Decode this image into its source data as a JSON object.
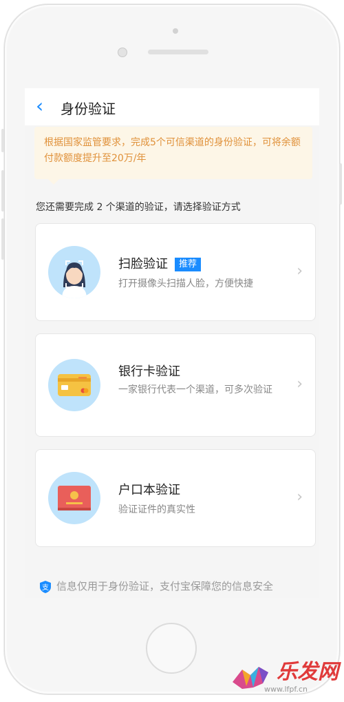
{
  "header": {
    "title": "身份验证",
    "back_icon": "chevron-left-icon"
  },
  "notice": {
    "text": "根据国家监管要求，完成5个可信渠道的身份验证，可将余额付款额度提升至20万/年"
  },
  "prompt": "您还需要完成 2 个渠道的验证，请选择验证方式",
  "methods": [
    {
      "title": "扫脸验证",
      "badge": "推荐",
      "desc": "打开摄像头扫描人脸，方便快捷",
      "icon": "face-scan-icon"
    },
    {
      "title": "银行卡验证",
      "desc": "一家银行代表一个渠道，可多次验证",
      "icon": "bank-card-icon"
    },
    {
      "title": "户口本验证",
      "desc": "验证证件的真实性",
      "icon": "household-register-icon"
    }
  ],
  "footer": {
    "text": "信息仅用于身份验证，支付宝保障您的信息安全",
    "icon": "shield-icon"
  },
  "watermark": {
    "title": "乐发网",
    "url": "www.lfpf.cn"
  },
  "colors": {
    "accent": "#1a8cff",
    "notice_text": "#e0913a",
    "notice_bg": "#fdf6e7"
  }
}
